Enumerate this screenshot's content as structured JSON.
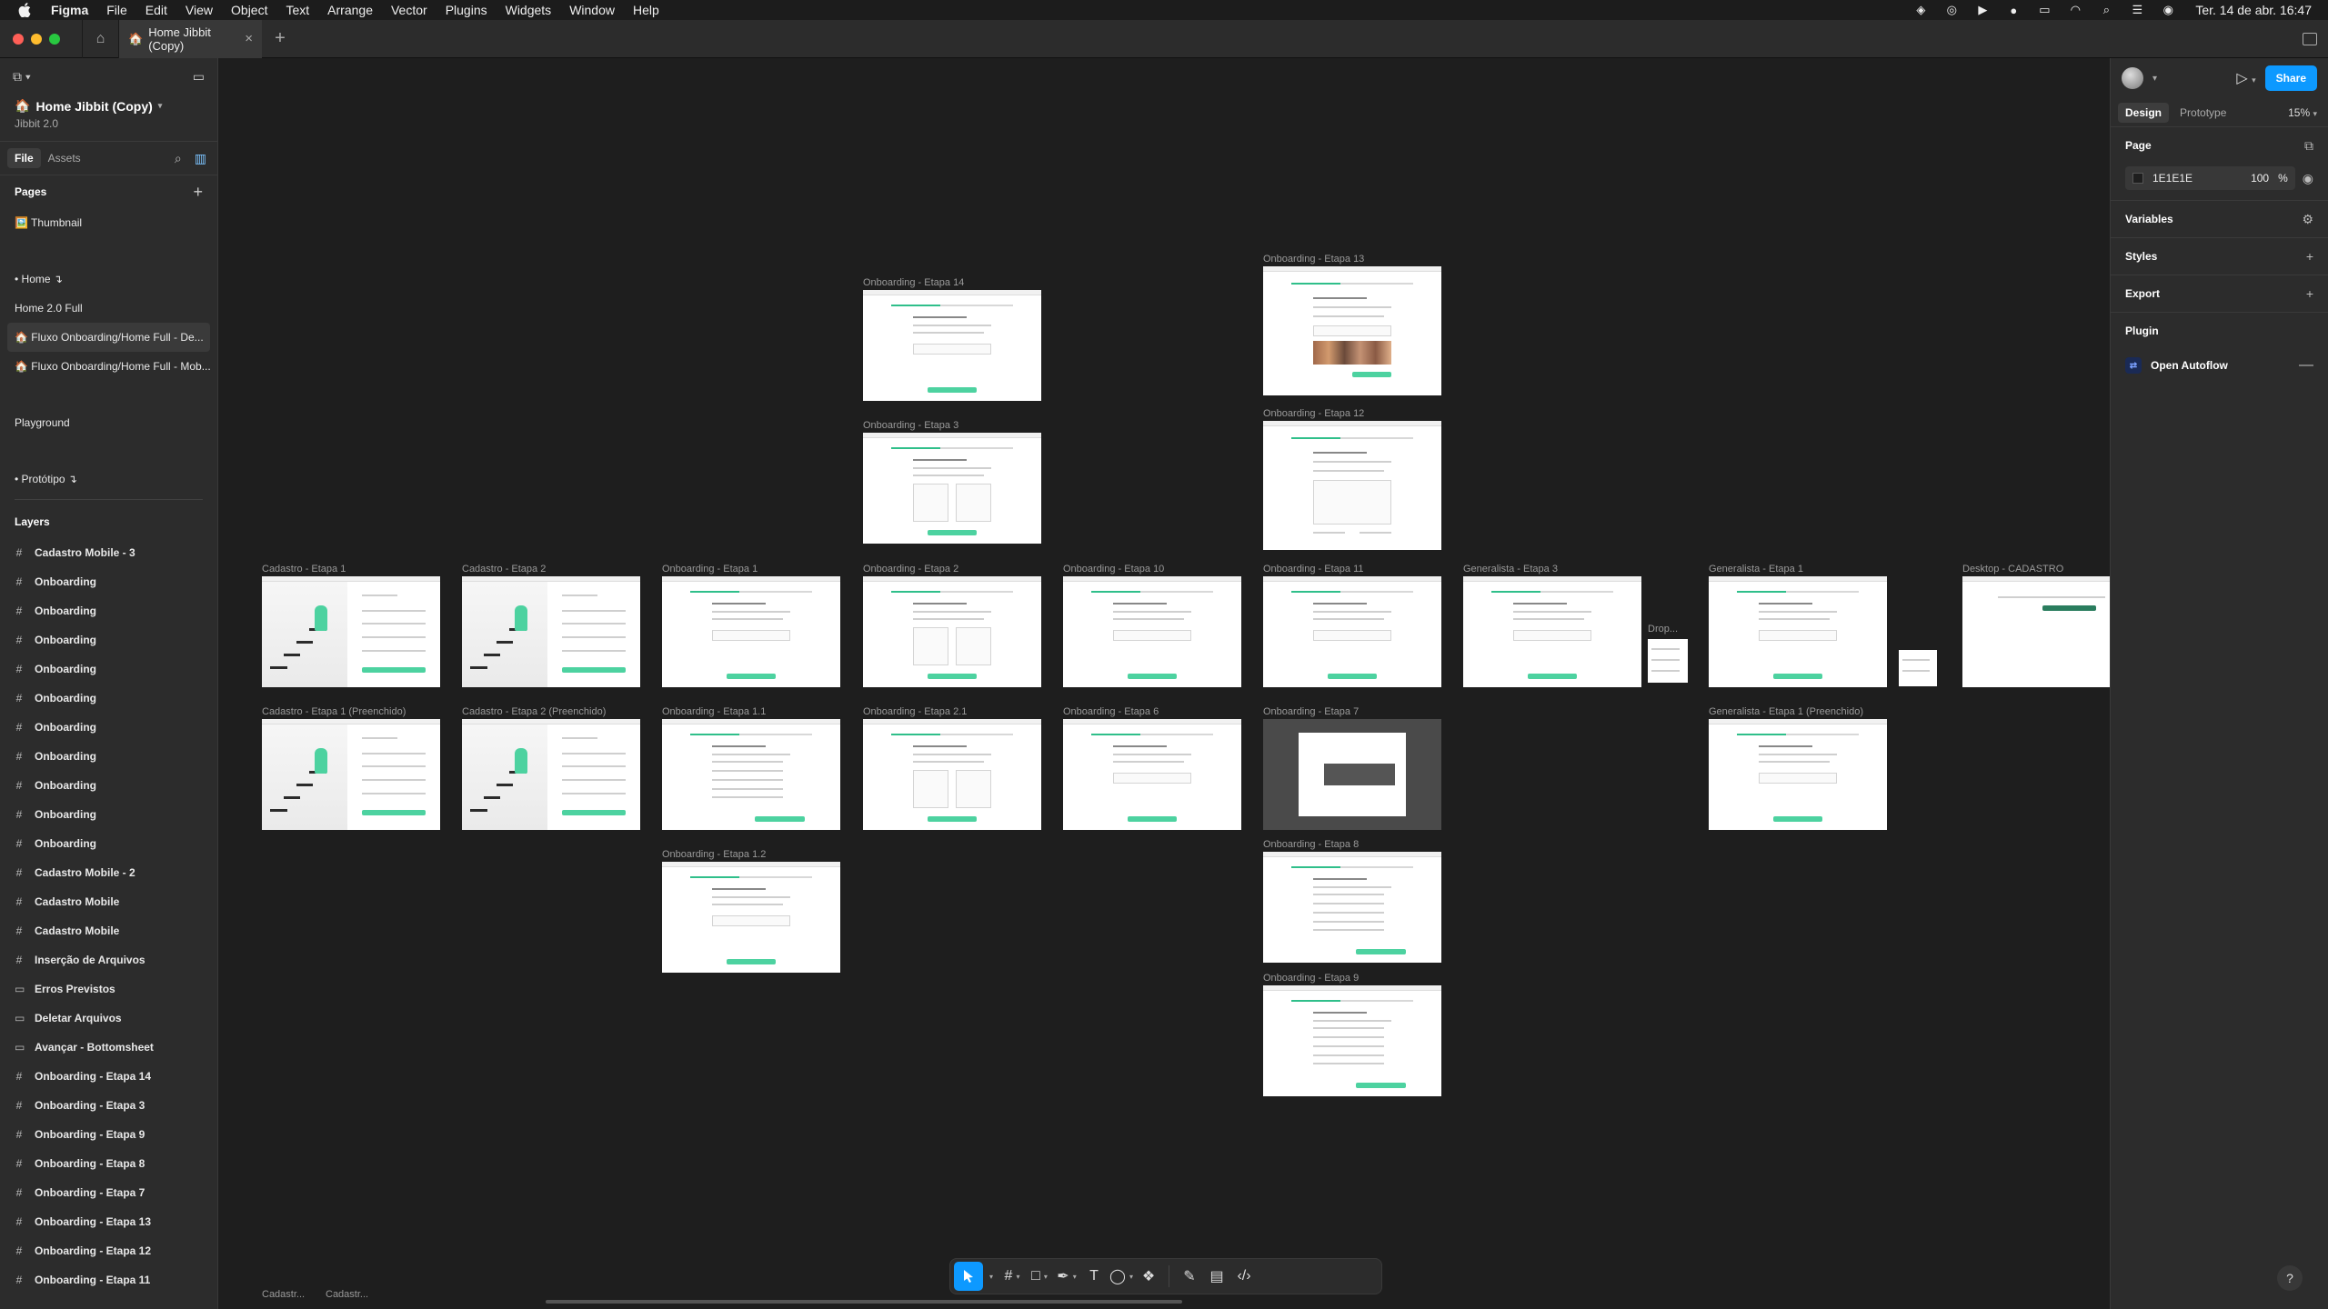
{
  "menubar": {
    "app": "Figma",
    "items": [
      "File",
      "Edit",
      "View",
      "Object",
      "Text",
      "Arrange",
      "Vector",
      "Plugins",
      "Widgets",
      "Window",
      "Help"
    ],
    "clock": "Ter. 14 de abr.  16:47"
  },
  "tabbar": {
    "file_tab": "Home Jibbit (Copy)",
    "add": "+"
  },
  "left": {
    "file_title": "Home Jibbit (Copy)",
    "file_subtitle": "Jibbit 2.0",
    "tabs": [
      "File",
      "Assets"
    ],
    "pages_heading": "Pages",
    "pages_add": "+",
    "pages": [
      {
        "label": "🖼️ Thumbnail"
      },
      {
        "label": "• Home ↴"
      },
      {
        "label": "Home 2.0 Full"
      },
      {
        "label": "🏠 Fluxo Onboarding/Home Full - De..."
      },
      {
        "label": "🏠 Fluxo Onboarding/Home Full - Mob..."
      },
      {
        "label": "Playground"
      },
      {
        "label": "• Protótipo ↴"
      }
    ],
    "layers_heading": "Layers",
    "layers": [
      {
        "icon": "#",
        "label": "Cadastro Mobile - 3"
      },
      {
        "icon": "#",
        "label": "Onboarding"
      },
      {
        "icon": "#",
        "label": "Onboarding"
      },
      {
        "icon": "#",
        "label": "Onboarding"
      },
      {
        "icon": "#",
        "label": "Onboarding"
      },
      {
        "icon": "#",
        "label": "Onboarding"
      },
      {
        "icon": "#",
        "label": "Onboarding"
      },
      {
        "icon": "#",
        "label": "Onboarding"
      },
      {
        "icon": "#",
        "label": "Onboarding"
      },
      {
        "icon": "#",
        "label": "Onboarding"
      },
      {
        "icon": "#",
        "label": "Onboarding"
      },
      {
        "icon": "#",
        "label": "Cadastro Mobile - 2"
      },
      {
        "icon": "#",
        "label": "Cadastro Mobile"
      },
      {
        "icon": "#",
        "label": "Cadastro Mobile"
      },
      {
        "icon": "#",
        "label": "Inserção de Arquivos"
      },
      {
        "icon": "▭",
        "label": "Erros Previstos"
      },
      {
        "icon": "▭",
        "label": "Deletar Arquivos"
      },
      {
        "icon": "▭",
        "label": "Avançar - Bottomsheet"
      },
      {
        "icon": "#",
        "label": "Onboarding - Etapa 14"
      },
      {
        "icon": "#",
        "label": "Onboarding - Etapa 3"
      },
      {
        "icon": "#",
        "label": "Onboarding - Etapa 9"
      },
      {
        "icon": "#",
        "label": "Onboarding - Etapa 8"
      },
      {
        "icon": "#",
        "label": "Onboarding - Etapa 7"
      },
      {
        "icon": "#",
        "label": "Onboarding - Etapa 13"
      },
      {
        "icon": "#",
        "label": "Onboarding - Etapa 12"
      },
      {
        "icon": "#",
        "label": "Onboarding - Etapa 11"
      }
    ]
  },
  "right": {
    "share": "Share",
    "tabs": [
      "Design",
      "Prototype"
    ],
    "zoom": "15%",
    "page_heading": "Page",
    "page_color": "1E1E1E",
    "page_opacity": "100",
    "page_opacity_unit": "%",
    "variables": "Variables",
    "styles": "Styles",
    "export": "Export",
    "plugin_heading": "Plugin",
    "plugin_name": "Open Autoflow",
    "help": "?"
  },
  "canvas": {
    "frames": [
      {
        "id": "f14",
        "label": "Onboarding - Etapa 14",
        "kind": "form"
      },
      {
        "id": "f3",
        "label": "Onboarding - Etapa 3",
        "kind": "cards"
      },
      {
        "id": "f13",
        "label": "Onboarding - Etapa 13",
        "kind": "photos"
      },
      {
        "id": "f12",
        "label": "Onboarding - Etapa 12",
        "kind": "upload"
      },
      {
        "id": "c1",
        "label": "Cadastro - Etapa 1",
        "kind": "signup"
      },
      {
        "id": "c2",
        "label": "Cadastro - Etapa 2",
        "kind": "signup"
      },
      {
        "id": "o1",
        "label": "Onboarding - Etapa 1",
        "kind": "form"
      },
      {
        "id": "o2",
        "label": "Onboarding - Etapa 2",
        "kind": "cards"
      },
      {
        "id": "o10",
        "label": "Onboarding - Etapa 10",
        "kind": "form"
      },
      {
        "id": "o11",
        "label": "Onboarding - Etapa 11",
        "kind": "form"
      },
      {
        "id": "g3",
        "label": "Generalista - Etapa 3",
        "kind": "form"
      },
      {
        "id": "g1",
        "label": "Generalista - Etapa 1",
        "kind": "form"
      },
      {
        "id": "dc",
        "label": "Desktop - CADASTRO",
        "kind": "desktop"
      },
      {
        "id": "c1p",
        "label": "Cadastro - Etapa 1 (Preenchido)",
        "kind": "signup"
      },
      {
        "id": "c2p",
        "label": "Cadastro - Etapa 2 (Preenchido)",
        "kind": "signup"
      },
      {
        "id": "o11b",
        "label": "Onboarding - Etapa 1.1",
        "kind": "list"
      },
      {
        "id": "o21",
        "label": "Onboarding - Etapa 2.1",
        "kind": "cards"
      },
      {
        "id": "o6",
        "label": "Onboarding - Etapa 6",
        "kind": "form"
      },
      {
        "id": "o7",
        "label": "Onboarding - Etapa 7",
        "kind": "modal"
      },
      {
        "id": "g1p",
        "label": "Generalista - Etapa 1 (Preenchido)",
        "kind": "form"
      },
      {
        "id": "o12",
        "label": "Onboarding - Etapa 1.2",
        "kind": "form"
      },
      {
        "id": "o8",
        "label": "Onboarding - Etapa 8",
        "kind": "list"
      },
      {
        "id": "o9",
        "label": "Onboarding - Etapa 9",
        "kind": "list"
      }
    ],
    "drop_label": "Drop...",
    "bottom_labels": [
      "Cadastr...",
      "Cadastr..."
    ]
  },
  "colors": {
    "accent": "#0d99ff",
    "brand_green": "#4dd2a0",
    "canvas_bg": "#1e1e1e"
  }
}
